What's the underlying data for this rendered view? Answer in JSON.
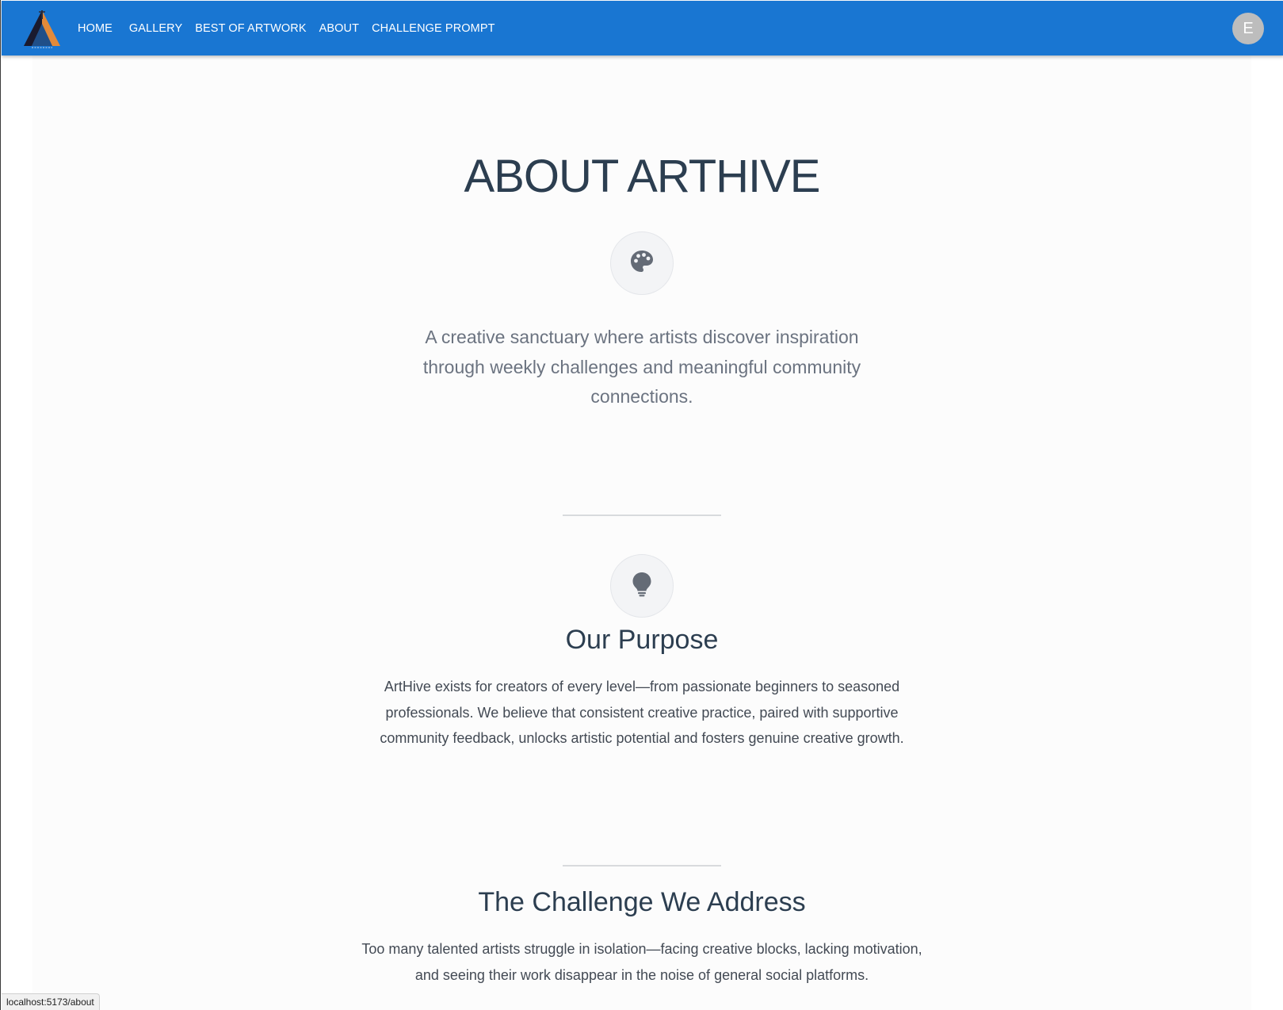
{
  "nav": {
    "logo_icon": "arthive-logo",
    "links": [
      "HOME",
      "GALLERY",
      "BEST OF ARTWORK",
      "ABOUT",
      "CHALLENGE PROMPT"
    ],
    "avatar_letter": "E"
  },
  "hero": {
    "title": "ABOUT ARTHIVE",
    "icon": "palette-icon",
    "tagline": "A creative sanctuary where artists discover inspiration through weekly challenges and meaningful community connections."
  },
  "purpose": {
    "icon": "lightbulb-icon",
    "title": "Our Purpose",
    "text": "ArtHive exists for creators of every level—from passionate beginners to seasoned professionals. We believe that consistent creative practice, paired with supportive community feedback, unlocks artistic potential and fosters genuine creative growth."
  },
  "challenge": {
    "title": "The Challenge We Address",
    "text": "Too many talented artists struggle in isolation—facing creative blocks, lacking motivation, and seeing their work disappear in the noise of general social platforms."
  },
  "status_bar": {
    "url": "localhost:5173/about"
  },
  "colors": {
    "navbar": "#1976d2",
    "heading": "#2c3e50",
    "page_background": "#fcfcfc"
  }
}
